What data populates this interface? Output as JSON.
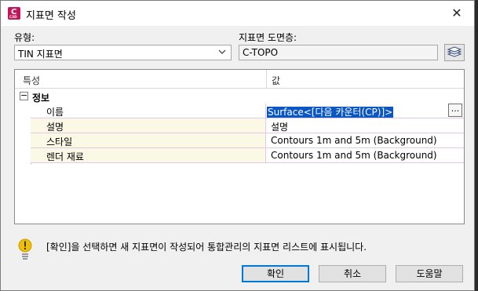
{
  "window": {
    "title": "지표면 작성",
    "app_icon_letter": "C",
    "app_icon_sub": "C3D",
    "close_glyph": "✕"
  },
  "form": {
    "type_label": "유형:",
    "type_value": "TIN 지표면",
    "layer_label": "지표면 도면층:",
    "layer_value": "C-TOPO"
  },
  "grid": {
    "col_property": "특성",
    "col_value": "값",
    "group_label": "정보",
    "expander_glyph": "−",
    "rows": [
      {
        "name": "이름",
        "value": "Surface<[다음 카운터(CP)]>"
      },
      {
        "name": "설명",
        "value": "설명"
      },
      {
        "name": "스타일",
        "value": "Contours 1m and 5m (Background)"
      },
      {
        "name": "렌더 재료",
        "value": "Contours 1m and 5m (Background)"
      }
    ],
    "ellipsis_label": "..."
  },
  "info": {
    "message": "[확인]을 선택하면 새 지표면이 작성되어 통합관리의 지표면 리스트에 표시됩니다."
  },
  "buttons": {
    "ok": "확인",
    "cancel": "취소",
    "help": "도움말"
  },
  "colors": {
    "selection": "#0a56c2",
    "icon_magenta": "#c2185b",
    "warning_yellow": "#f0c000"
  }
}
